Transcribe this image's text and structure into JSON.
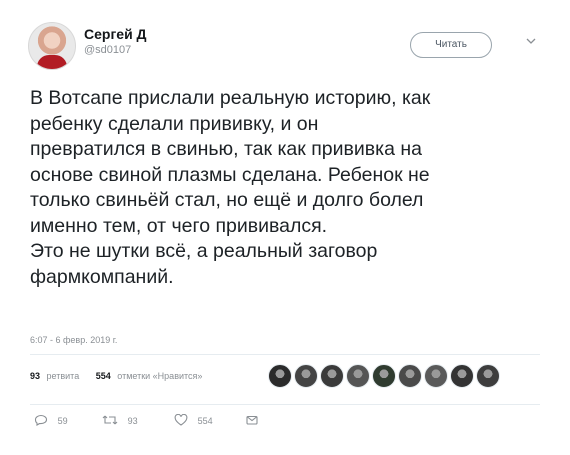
{
  "author": {
    "name": "Сергей Д",
    "handle": "@sd0107"
  },
  "follow_button": "Читать",
  "tweet_lines": [
    "В Вотсапе прислали реальную историю, как",
    "ребенку сделали прививку, и он",
    "превратился в свинью, так как прививка на",
    "основе свиной плазмы сделана. Ребенок не",
    "только свиньёй стал, но ещё и долго болел",
    "именно тем, от чего прививался.",
    "Это не шутки всё, а реальный заговор",
    "фармкомпаний."
  ],
  "timestamp": "6:07 - 6 февр. 2019 г.",
  "stats": {
    "retweets_count": "93",
    "retweets_label": "ретвита",
    "likes_count": "554",
    "likes_label": "отметки «Нравится»"
  },
  "liker_avatar_colors": [
    "#2b2b2b",
    "#444444",
    "#3a3a3a",
    "#555555",
    "#2f3b2f",
    "#4a4a4a",
    "#5a5a5a",
    "#333333",
    "#3d3d3d"
  ],
  "actions": {
    "reply_count": "59",
    "retweet_count": "93",
    "like_count": "554"
  },
  "icons": {
    "reply": "reply-icon",
    "retweet": "retweet-icon",
    "like": "heart-icon",
    "share": "share-icon",
    "more": "chevron-down-icon"
  }
}
